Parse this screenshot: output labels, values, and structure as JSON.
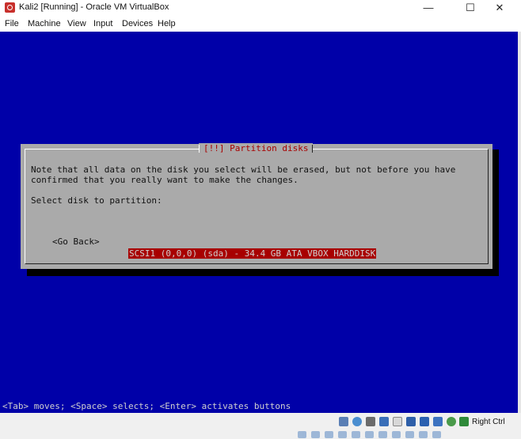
{
  "window": {
    "title": "Kali2 [Running] - Oracle VM VirtualBox",
    "minimize_glyph": "—",
    "maximize_glyph": "☐",
    "close_glyph": "✕"
  },
  "menu": {
    "items": [
      "File",
      "Machine",
      "View",
      "Input",
      "Devices",
      "Help"
    ]
  },
  "installer": {
    "dialog_title": "[!!] Partition disks",
    "message_line1": "Note that all data on the disk you select will be erased, but not before you have",
    "message_line2": "confirmed that you really want to make the changes.",
    "prompt": "Select disk to partition:",
    "disk_option": "SCSI1 (0,0,0) (sda) - 34.4 GB ATA VBOX HARDDISK",
    "go_back": "<Go Back>",
    "status_line": "<Tab> moves; <Space> selects; <Enter> activates buttons"
  },
  "statusbar": {
    "host_key": "Right Ctrl",
    "icons": [
      "hard-disk-icon",
      "optical-drive-icon",
      "audio-icon",
      "network-icon",
      "usb-icon",
      "shared-folders-icon",
      "display-icon",
      "recording-icon",
      "mouse-integration-icon",
      "keyboard-capture-icon"
    ]
  },
  "colors": {
    "screen_bg": "#0000a8",
    "dialog_bg": "#aaaaaa",
    "highlight_bg": "#a80000",
    "title_red": "#a80000"
  }
}
